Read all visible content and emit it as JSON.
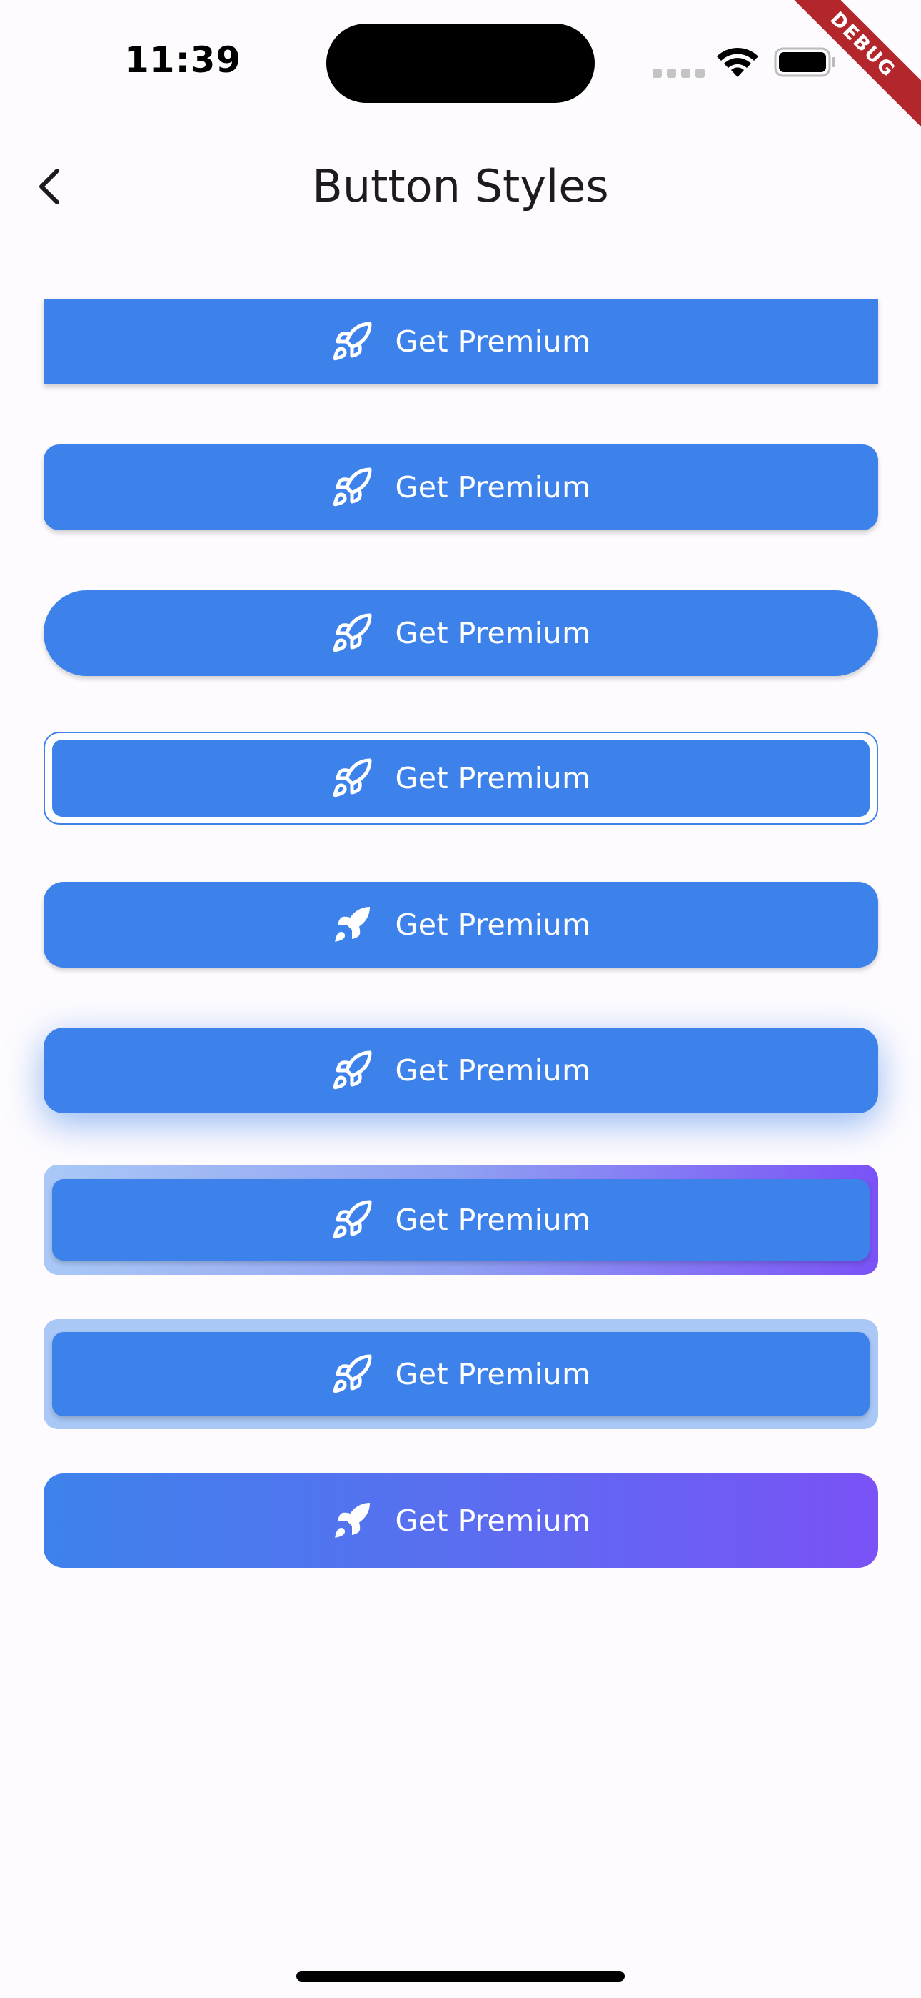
{
  "status_bar": {
    "time": "11:39",
    "debug_label": "DEBUG"
  },
  "app_bar": {
    "title": "Button Styles",
    "back_icon": "chevron-left-icon"
  },
  "colors": {
    "primary": "#3d82eb",
    "gradient_end": "#7a52f6",
    "light_border": "#a9c8f6"
  },
  "buttons": [
    {
      "label": "Get Premium",
      "icon": "rocket-outline-icon",
      "style": "square"
    },
    {
      "label": "Get Premium",
      "icon": "rocket-outline-icon",
      "style": "rounded"
    },
    {
      "label": "Get Premium",
      "icon": "rocket-outline-icon",
      "style": "pill"
    },
    {
      "label": "Get Premium",
      "icon": "rocket-outline-icon",
      "style": "outlined-border"
    },
    {
      "label": "Get Premium",
      "icon": "rocket-filled-icon",
      "style": "rounded"
    },
    {
      "label": "Get Premium",
      "icon": "rocket-outline-icon",
      "style": "glow-shadow"
    },
    {
      "label": "Get Premium",
      "icon": "rocket-outline-icon",
      "style": "gradient-frame"
    },
    {
      "label": "Get Premium",
      "icon": "rocket-outline-icon",
      "style": "light-frame"
    },
    {
      "label": "Get Premium",
      "icon": "rocket-filled-icon",
      "style": "gradient-fill"
    }
  ]
}
